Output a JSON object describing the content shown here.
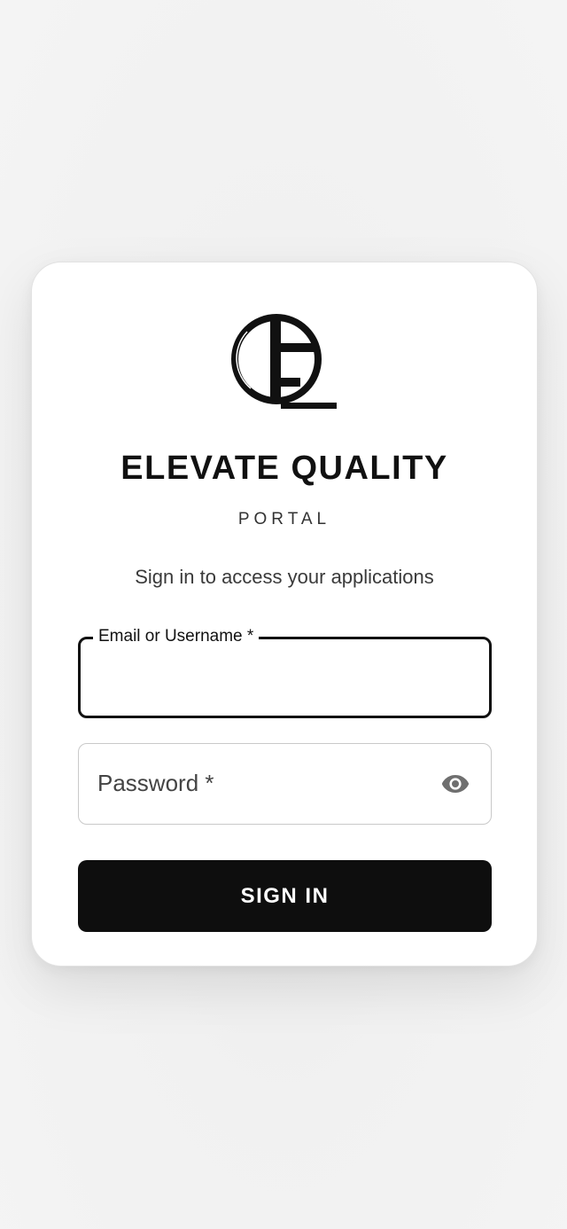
{
  "brand": {
    "title": "ELEVATE QUALITY",
    "subtitle": "PORTAL",
    "logo_icon": "eq-monogram-icon"
  },
  "tagline": "Sign in to access your applications",
  "form": {
    "email": {
      "label": "Email or Username *",
      "value": ""
    },
    "password": {
      "label": "Password *",
      "value": "",
      "toggle_icon": "eye-icon"
    },
    "submit_label": "SIGN IN"
  },
  "colors": {
    "background": "#f2f2f2",
    "card": "#ffffff",
    "primary_button": "#0e0e0e",
    "focus_border": "#111111",
    "idle_border": "#c9c9c9",
    "icon": "#6f6f6f"
  }
}
